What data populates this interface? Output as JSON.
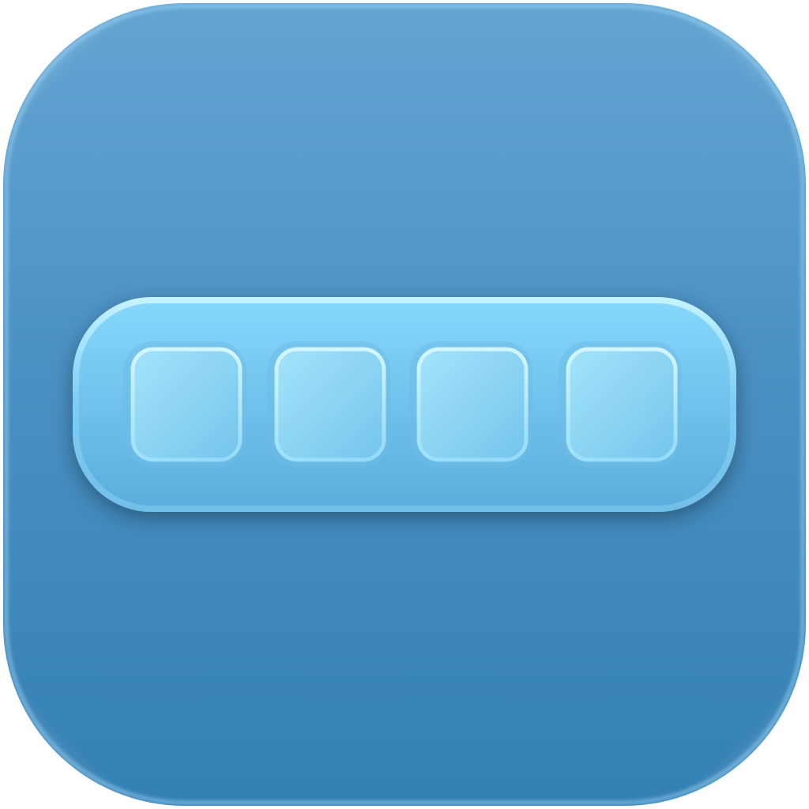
{
  "icon": {
    "name": "four-slot-bar-icon",
    "slot_count": 4,
    "colors": {
      "background_top": "#63a5d2",
      "background_bottom": "#3480b4",
      "bar_top": "#86d8fc",
      "bar_bottom": "#5aacdc",
      "slot_top": "#a4e4fa",
      "slot_bottom": "#74c4ec",
      "highlight": "#c8f4ff"
    }
  }
}
